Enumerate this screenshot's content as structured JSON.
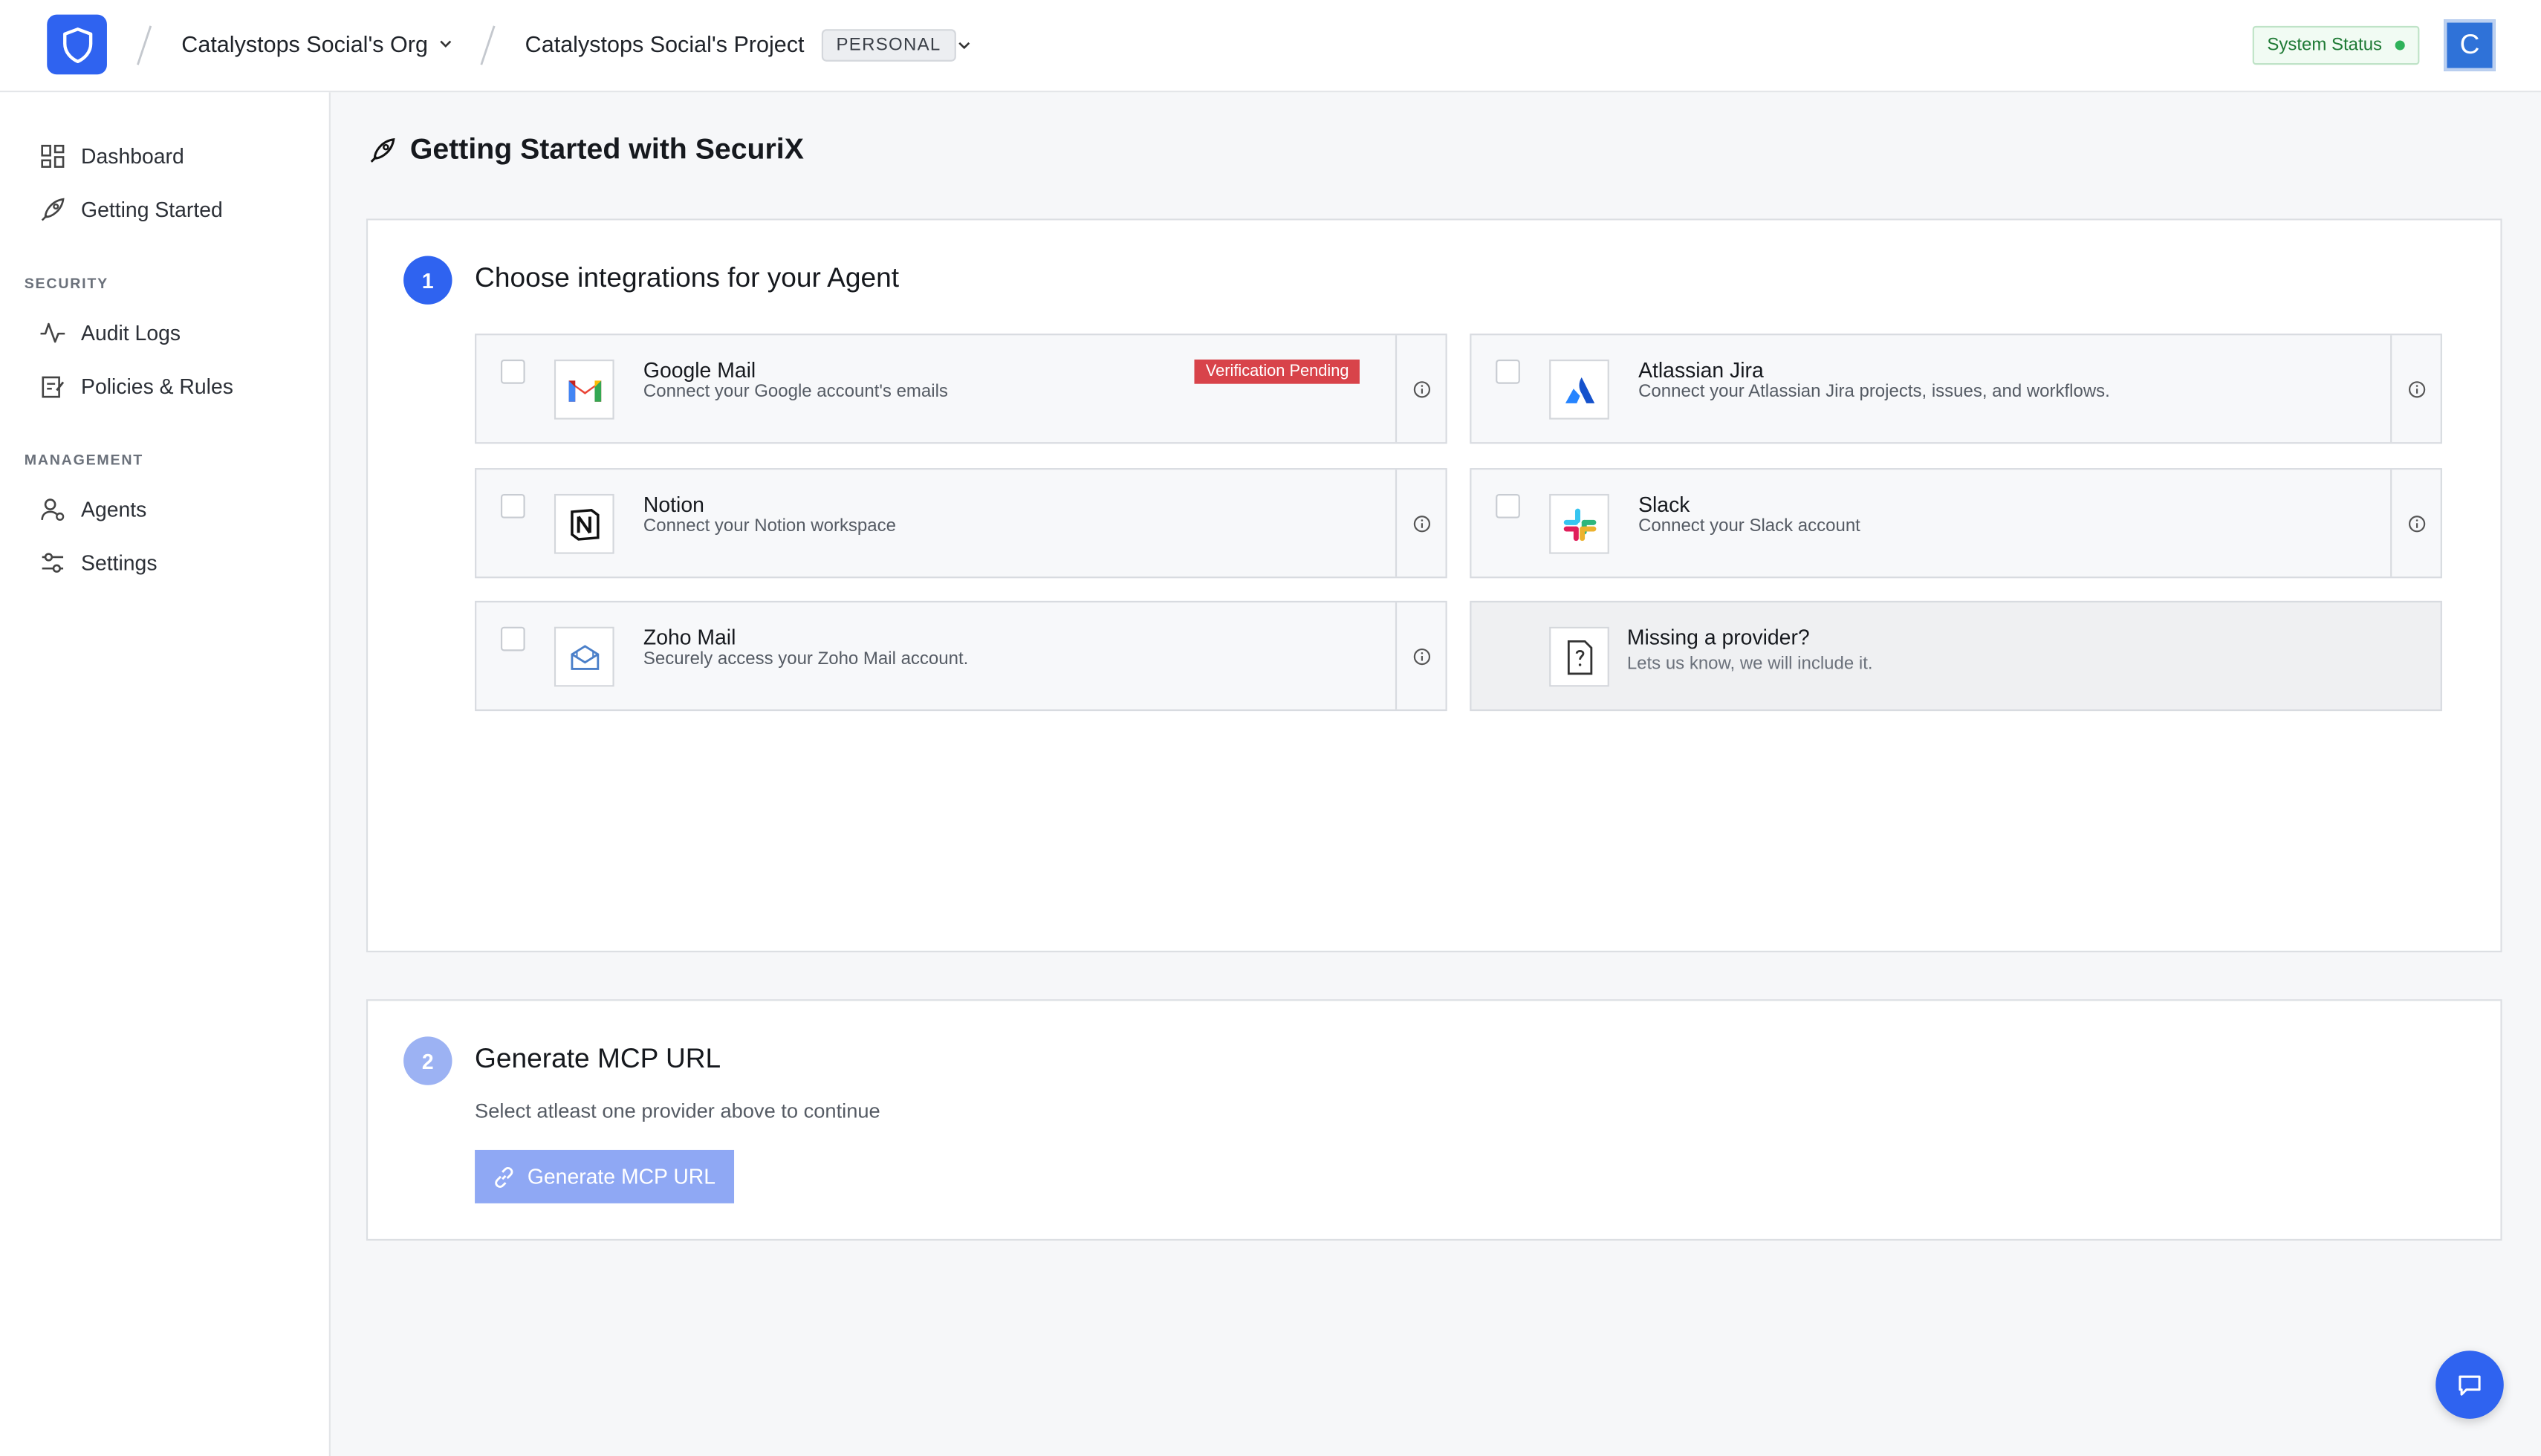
{
  "header": {
    "org_name": "Catalystops Social's Org",
    "project_name": "Catalystops Social's Project",
    "project_badge": "PERSONAL",
    "system_status": "System Status",
    "avatar_initial": "C"
  },
  "sidebar": {
    "items": [
      {
        "label": "Dashboard",
        "icon": "dashboard-icon"
      },
      {
        "label": "Getting Started",
        "icon": "rocket-icon"
      }
    ],
    "security_label": "SECURITY",
    "security_items": [
      {
        "label": "Audit Logs",
        "icon": "activity-icon"
      },
      {
        "label": "Policies & Rules",
        "icon": "policy-icon"
      }
    ],
    "management_label": "MANAGEMENT",
    "management_items": [
      {
        "label": "Agents",
        "icon": "agents-icon"
      },
      {
        "label": "Settings",
        "icon": "settings-icon"
      }
    ]
  },
  "main": {
    "title": "Getting Started with SecuriX",
    "step1": {
      "number": "1",
      "title": "Choose integrations for your Agent",
      "providers": [
        {
          "name": "Google Mail",
          "desc": "Connect your Google account's emails",
          "badge": "Verification Pending",
          "icon": "gmail-icon"
        },
        {
          "name": "Atlassian Jira",
          "desc": "Connect your Atlassian Jira projects, issues, and workflows.",
          "icon": "jira-icon"
        },
        {
          "name": "Notion",
          "desc": "Connect your Notion workspace",
          "icon": "notion-icon"
        },
        {
          "name": "Slack",
          "desc": "Connect your Slack account",
          "icon": "slack-icon"
        },
        {
          "name": "Zoho Mail",
          "desc": "Securely access your Zoho Mail account.",
          "icon": "zoho-mail-icon"
        }
      ],
      "missing": {
        "title": "Missing a provider?",
        "desc": "Lets us know, we will include it.",
        "icon": "question-icon"
      }
    },
    "step2": {
      "number": "2",
      "title": "Generate MCP URL",
      "subtitle": "Select atleast one provider above to continue",
      "button": "Generate MCP URL"
    }
  },
  "colors": {
    "accent": "#2f63f0",
    "danger": "#d8434a",
    "success": "#2fb35a"
  }
}
